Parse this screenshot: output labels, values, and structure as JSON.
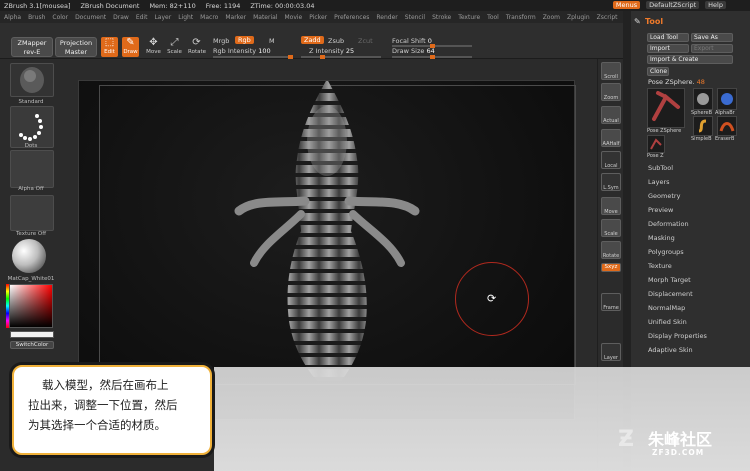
{
  "titlebar": {
    "app": "ZBrush  3.1[mousea]",
    "doc": "ZBrush Document",
    "mem": "Mem: 82+110",
    "free": "Free: 1194",
    "ztime": "ZTime: 00:00:03.04",
    "menus_btn": "Menus",
    "defaultzscript": "DefaultZScript",
    "help": "Help"
  },
  "menubar": [
    "Alpha",
    "Brush",
    "Color",
    "Document",
    "Draw",
    "Edit",
    "Layer",
    "Light",
    "Macro",
    "Marker",
    "Material",
    "Movie",
    "Picker",
    "Preferences",
    "Render",
    "Stencil",
    "Stroke",
    "Texture",
    "Tool",
    "Transform",
    "Zoom",
    "Zplugin",
    "Zscript"
  ],
  "toolbar": {
    "zmapper": "ZMapper",
    "zmapper_sub": "rev-E",
    "projection": "Projection",
    "projection_sub": "Master",
    "edit": "Edit",
    "draw": "Draw",
    "move": "Move",
    "scale": "Scale",
    "rotate": "Rotate",
    "mrgb": "Mrgb",
    "rgb": "Rgb",
    "m": "M",
    "rgb_intensity_label": "Rgb Intensity",
    "rgb_intensity_value": "100",
    "zadd": "Zadd",
    "zsub": "Zsub",
    "zcut": "Zcut",
    "z_intensity_label": "Z Intensity",
    "z_intensity_value": "25",
    "focal_shift_label": "Focal Shift",
    "focal_shift_value": "0",
    "draw_size_label": "Draw Size",
    "draw_size_value": "64"
  },
  "leftshelf": {
    "standard": "Standard",
    "dots": "Dots",
    "alpha_off": "Alpha Off",
    "texture_off": "Texture Off",
    "matcap": "MatCap_White01",
    "switchcolor": "SwitchColor"
  },
  "rightshelf": [
    "Scroll",
    "Zoom",
    "Actual",
    "AAHalf",
    "Local",
    "L.Sym",
    "Move",
    "Scale",
    "Rotate",
    "Frame",
    "Layer"
  ],
  "rightshelf_xyz": "Sxyz",
  "toolpanel": {
    "title": "Tool",
    "load_tool": "Load Tool",
    "save_as": "Save As",
    "import": "Import",
    "export": "Export",
    "import_create": "Import & Create",
    "clone": "Clone",
    "current_tool": "Pose ZSphere.",
    "current_tool_count": "48",
    "thumb_labels": [
      "Pose ZSphere",
      "SphereB",
      "AlphaBr",
      "SimpleB",
      "EraserB",
      "Pose Z"
    ],
    "subpalettes": [
      "SubTool",
      "Layers",
      "Geometry",
      "Preview",
      "Deformation",
      "Masking",
      "Polygroups",
      "Texture",
      "Morph Target",
      "Displacement",
      "NormalMap",
      "Unified Skin",
      "Display Properties",
      "Adaptive Skin"
    ]
  },
  "caption": {
    "line1": "载入模型，然后在画布上",
    "line2": "拉出来，调整一下位置，然后",
    "line3": "为其选择一个合适的材质。"
  },
  "watermark": {
    "text": "朱峰社区",
    "sub": "ZF3D.COM"
  },
  "colors": {
    "accent": "#e06a1a",
    "caption_border": "#f0b13a",
    "rotate_circle": "#b0291e"
  }
}
